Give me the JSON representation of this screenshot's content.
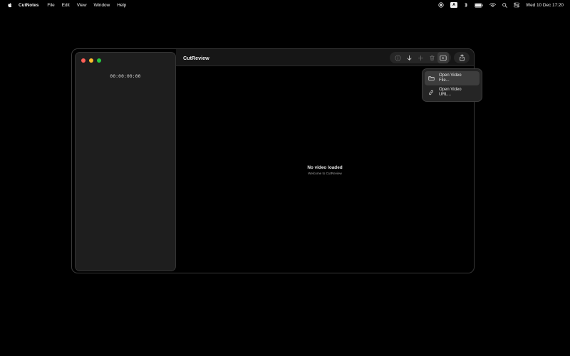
{
  "menubar": {
    "app_name": "CutNotes",
    "items": [
      "File",
      "Edit",
      "View",
      "Window",
      "Help"
    ],
    "clock": "Wed 10 Dec  17:20",
    "keyboard_badge": "A"
  },
  "window": {
    "title": "CutReview",
    "timecode": "00:00:00:00",
    "empty_title": "No video loaded",
    "empty_subtitle": "Welcome to CutReview"
  },
  "dropdown": {
    "items": [
      {
        "label_line1": "Open Video",
        "label_line2": "File..."
      },
      {
        "label_line1": "Open Video",
        "label_line2": "URL..."
      }
    ]
  },
  "colors": {
    "close": "#ff5f57",
    "minimize": "#febc2e",
    "maximize": "#28c840"
  }
}
